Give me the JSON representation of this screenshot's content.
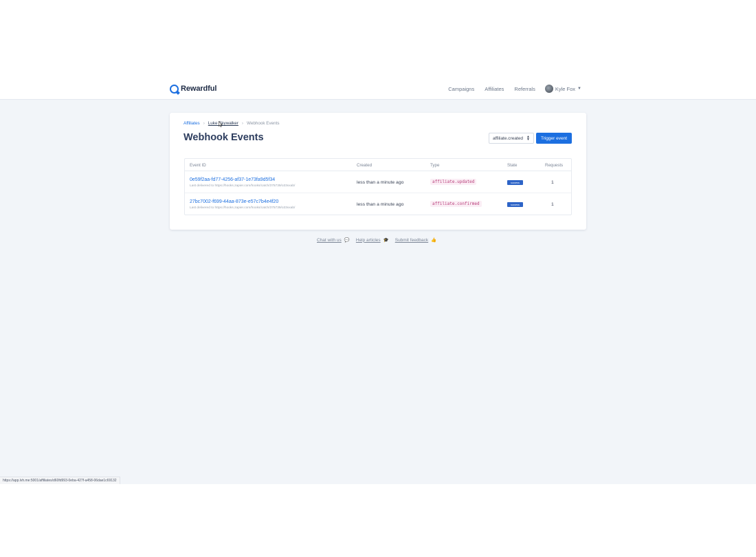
{
  "navbar": {
    "brand": "Rewardful",
    "links": [
      "Campaigns",
      "Affiliates",
      "Referrals"
    ],
    "user_name": "Kyle Fox"
  },
  "breadcrumb": {
    "root": "Affiliates",
    "affiliate": "Luke Skywalker",
    "current": "Webhook Events"
  },
  "page": {
    "title": "Webhook Events",
    "select_value": "affiliate.created",
    "trigger_label": "Trigger event"
  },
  "table": {
    "headers": [
      "Event ID",
      "Created",
      "Type",
      "State",
      "Requests"
    ],
    "rows": [
      {
        "event_id": "0e59f2aa-fd77-4256-af37-1e73fa9d5f34",
        "delivered": "Last delivered to https://hooks.zapier.com/hooks/catch/375739/o33vxab/",
        "created": "less than a minute ago",
        "type": "affiliate.updated",
        "state": "success",
        "requests": "1"
      },
      {
        "event_id": "27bc7002-f699-44aa-873e-e57c7b4e4f20",
        "delivered": "Last delivered to https://hooks.zapier.com/hooks/catch/375739/o33vxab/",
        "created": "less than a minute ago",
        "type": "affiliate.confirmed",
        "state": "success",
        "requests": "1"
      }
    ]
  },
  "footer": {
    "chat": "Chat with us",
    "chat_emoji": "💬",
    "help": "Help articles",
    "help_emoji": "🎓",
    "feedback": "Submit feedback",
    "feedback_emoji": "👍"
  },
  "status_bar": "https://app.lvh.me:5001/affiliates/d60fd993-0eba-427f-a458-06dae1c69132",
  "colors": {
    "accent": "#1c6fe0",
    "page_background": "#f2f5f9",
    "badge": "#2d64c7"
  }
}
